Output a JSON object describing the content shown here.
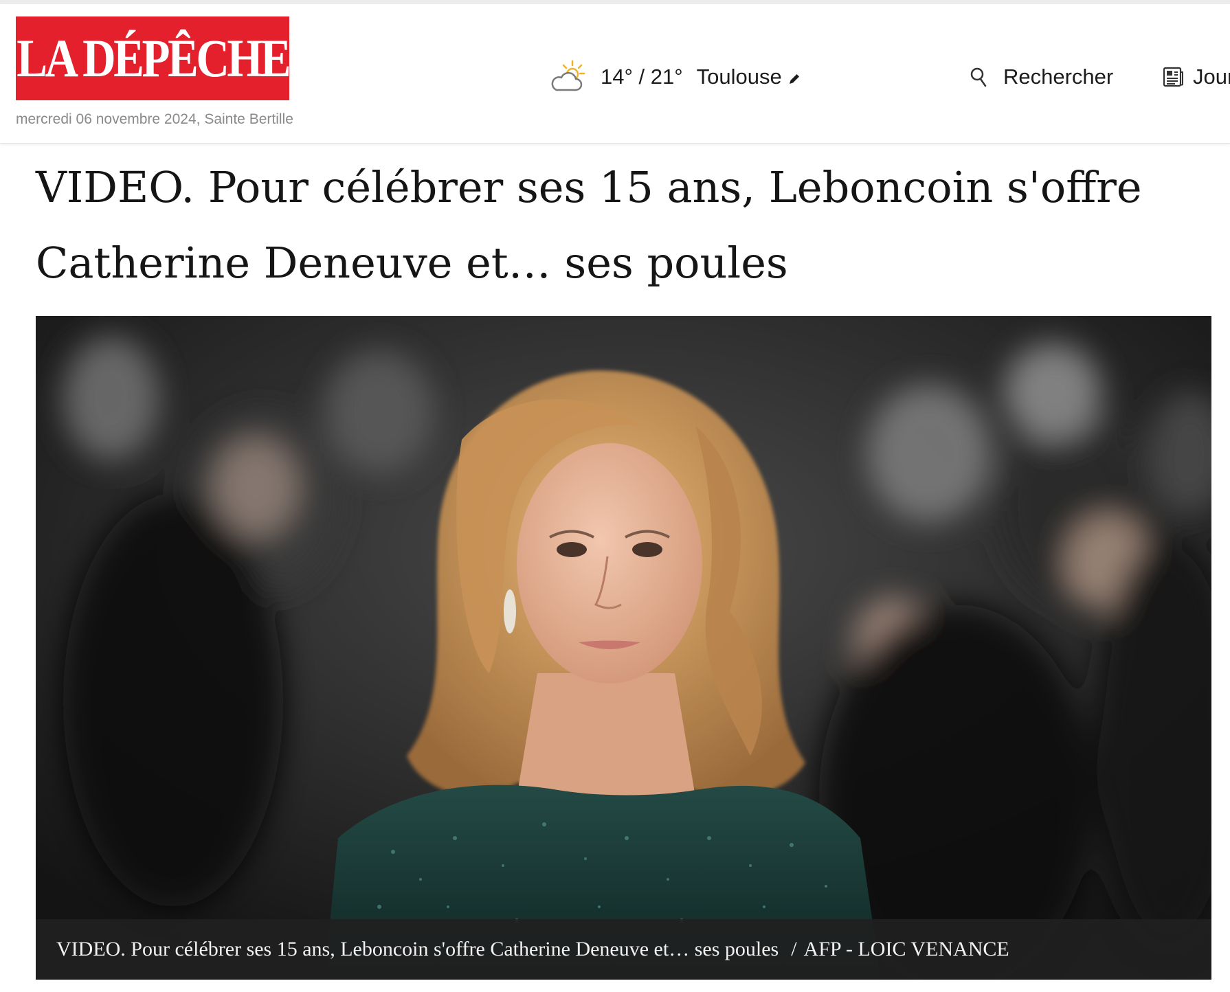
{
  "header": {
    "logo_text": "LA DÉPÊCHE",
    "logo_bg": "#e3202c",
    "date_line": "mercredi 06 novembre 2024, Sainte Bertille",
    "weather": {
      "icon": "partly-cloudy-icon",
      "temps": "14° / 21°",
      "city": "Toulouse"
    },
    "search_label": "Rechercher",
    "journal_label": "Journal"
  },
  "article": {
    "headline": "VIDEO. Pour célébrer ses 15 ans, Leboncoin s'offre Catherine Deneuve et… ses poules",
    "photo": {
      "caption": "VIDEO. Pour célébrer ses 15 ans, Leboncoin s'offre Catherine Deneuve et… ses poules",
      "separator": "/",
      "credit": "AFP - LOIC VENANCE"
    }
  }
}
